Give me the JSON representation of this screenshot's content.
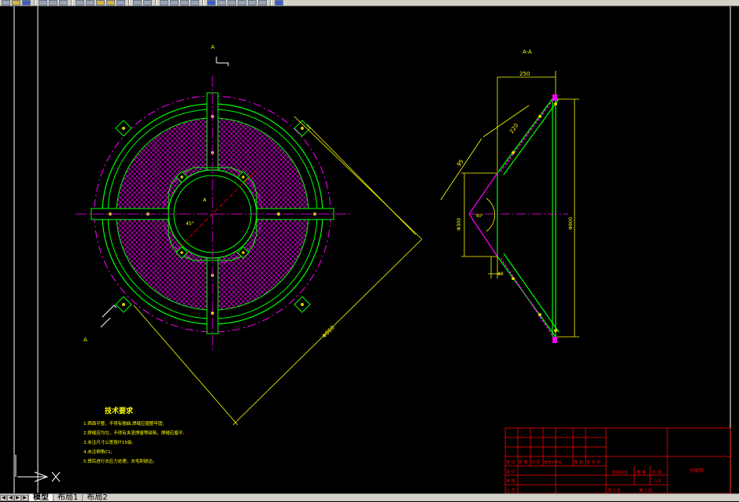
{
  "drawing": {
    "section_mark": "A",
    "center_label": "A",
    "angle_label": "45°",
    "diag_dim": "Φ860",
    "section_title": "A-A",
    "dim_top": "250",
    "dim_slant_a": "220",
    "dim_slant_b": "95",
    "dim_dia_small": "Φ300",
    "dim_dia_large": "Φ900",
    "dim_angle": "60°",
    "dim_bottom": "40"
  },
  "notes": {
    "title": "技术要求",
    "lines": [
      "1.筛面平整，不得有翘曲,焊缝应圆整牢固;",
      "2.焊缝应均匀，不得有夹渣焊瘤等缺陷，焊缝应磨平;",
      "3.未注尺寸公差按IT15级;",
      "4.未注倒角C1;",
      "5.焊后进行去应力处理，去毛刺锐边。"
    ]
  },
  "title_block": {
    "part_name": "分级筛",
    "row_labels": [
      "标 记",
      "设 计",
      "审 核",
      "工 艺"
    ],
    "header_labels": [
      "处 数",
      "分 区",
      "更改文件号",
      "签 名",
      "年 月 日"
    ],
    "stage_label": "阶段标记",
    "weight_label": "重 量",
    "scale_label": "比 例",
    "scale_value": "1:5",
    "sheets_total": "共 1 张",
    "sheet_no": "第 1 张"
  },
  "tabs": {
    "model": "模型",
    "layout1": "布局1",
    "layout2": "布局2"
  },
  "colors": {
    "background": "#000000",
    "outline": "#00ff00",
    "hatch": "#cc00cc",
    "centerline": "#ff00ff",
    "dimension": "#ffff00",
    "frame": "#ffffff",
    "titleblock": "#ff0000"
  }
}
